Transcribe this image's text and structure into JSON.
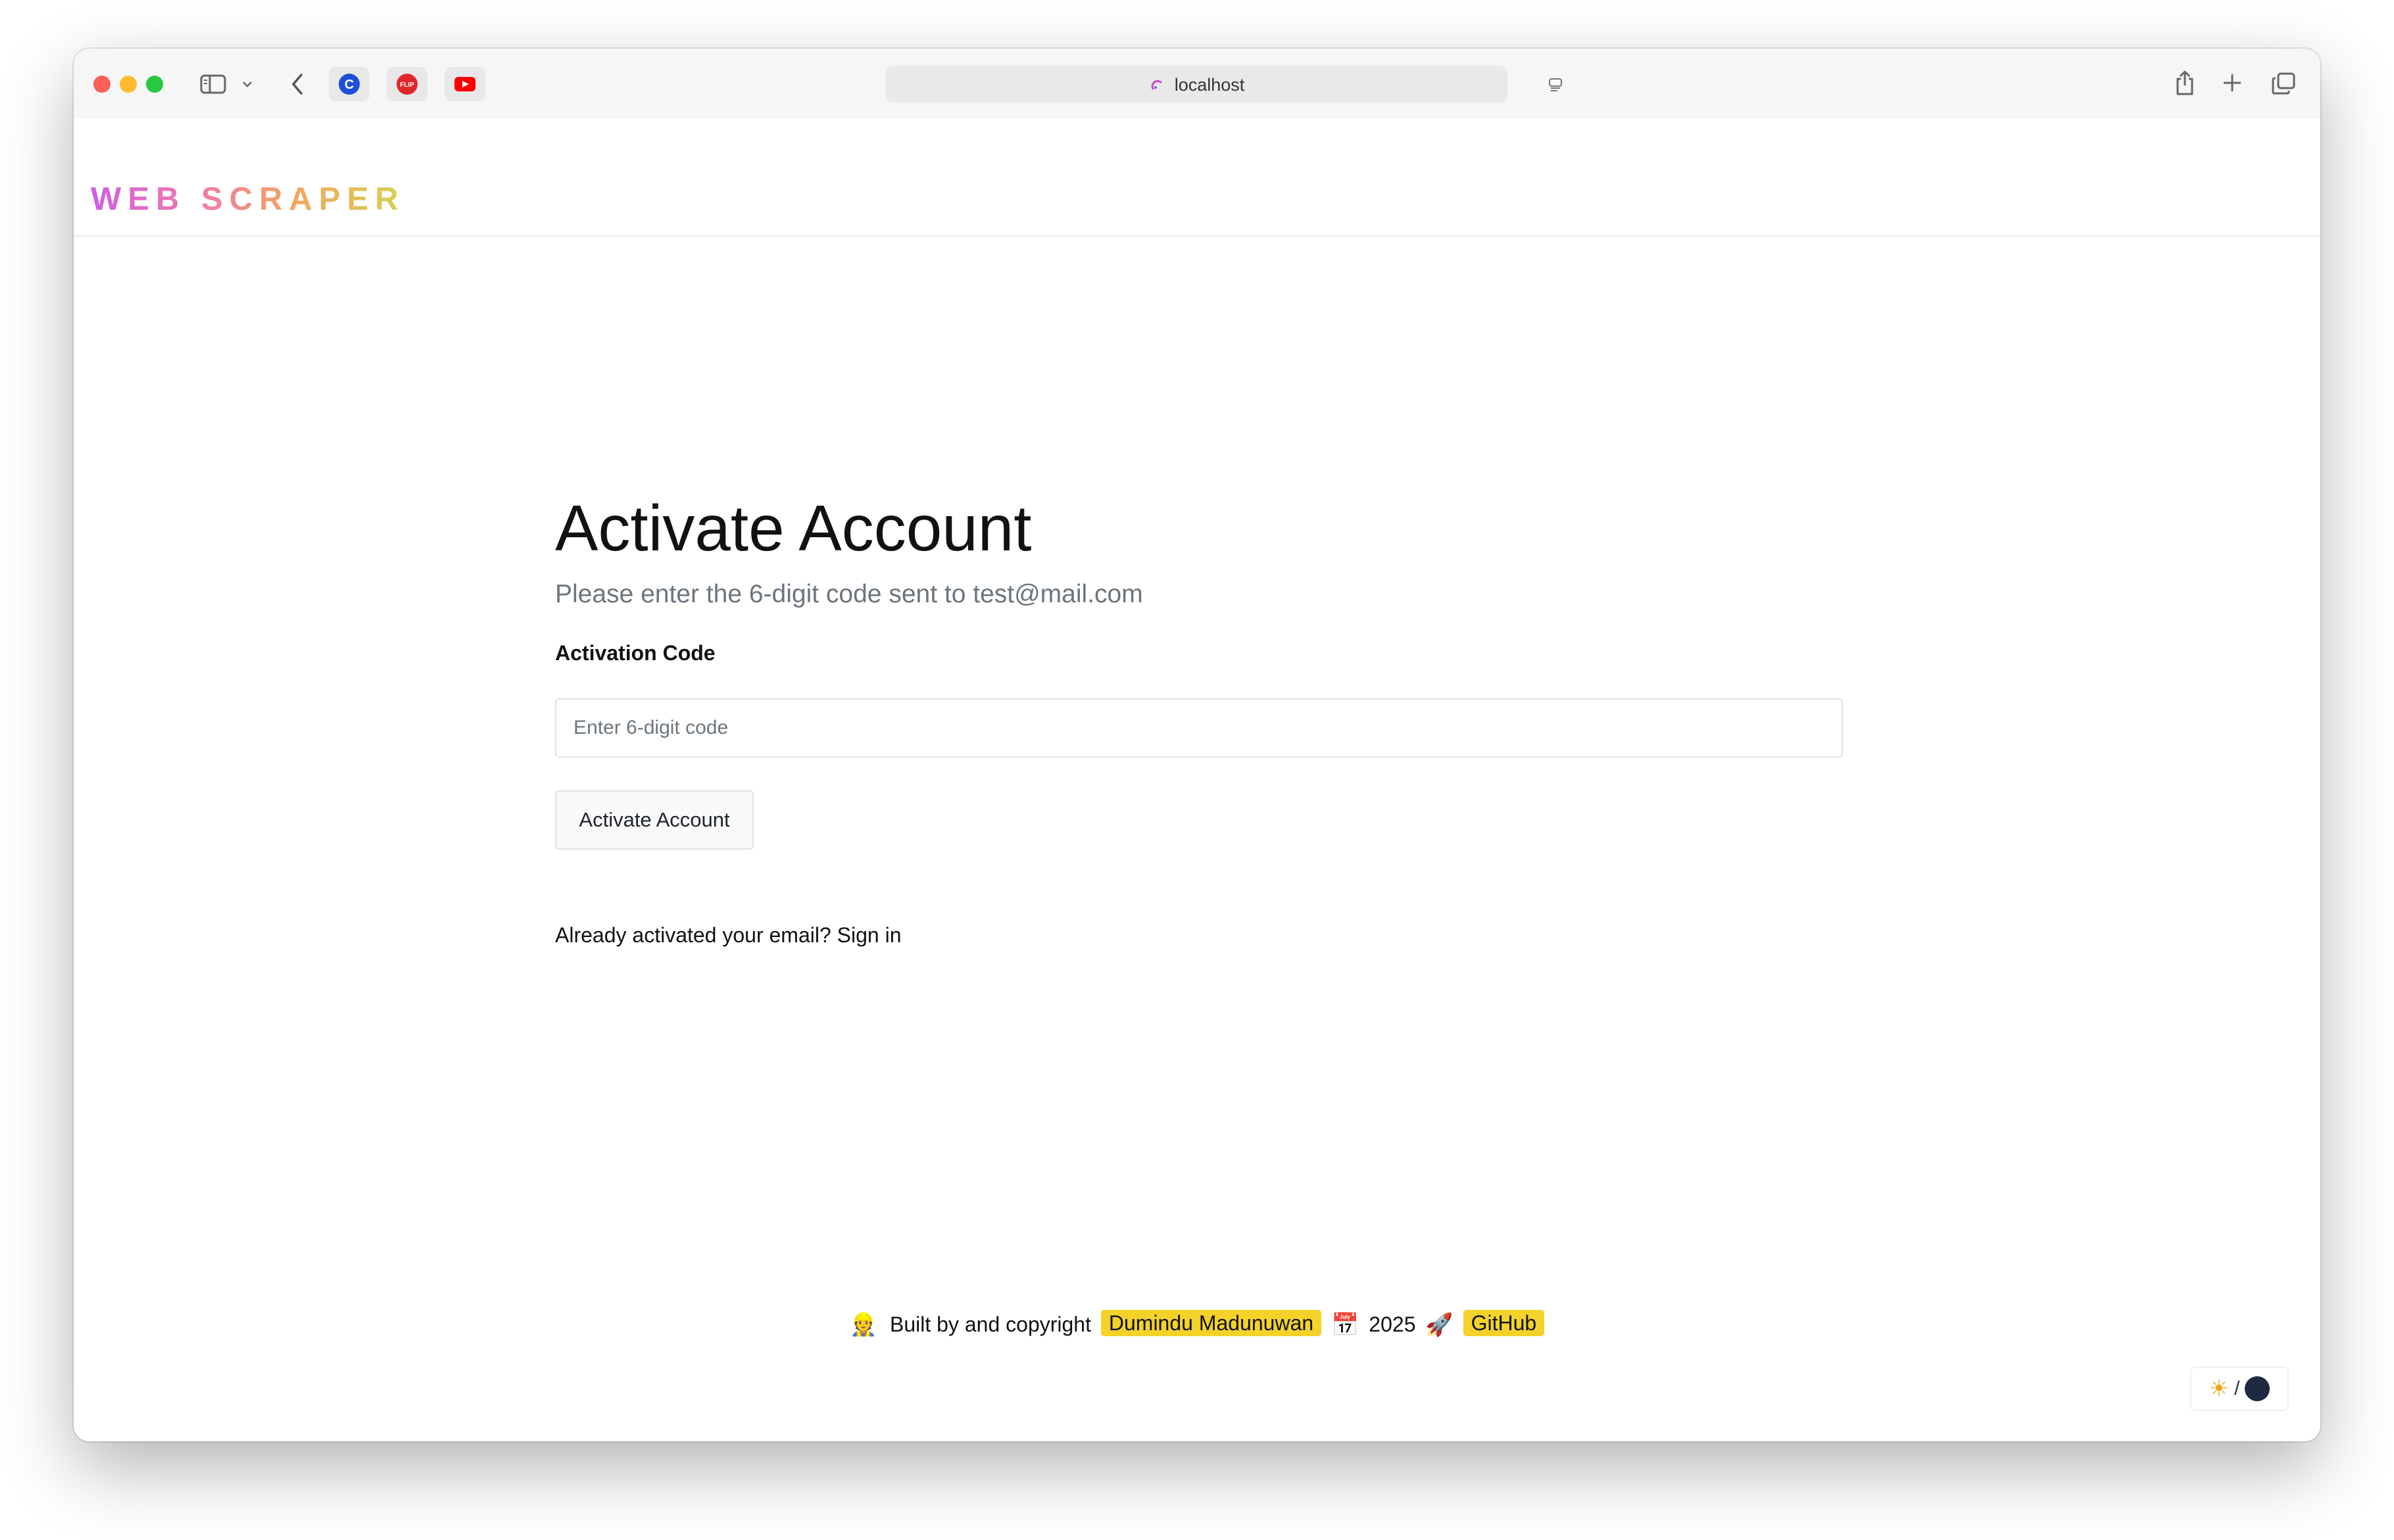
{
  "browser": {
    "url": "localhost",
    "traffic_colors": {
      "close": "#fe5f57",
      "minimize": "#febc2e",
      "zoom": "#28c840"
    },
    "favorites": [
      "c-logo-icon",
      "flip-logo-icon",
      "youtube-logo-icon"
    ]
  },
  "navbar": {
    "logo": "WEB SCRAPER"
  },
  "main": {
    "title": "Activate Account",
    "subtitle": "Please enter the 6-digit code sent to test@mail.com",
    "field_label": "Activation Code",
    "field_placeholder": "Enter 6-digit code",
    "field_value": "",
    "button_label": "Activate Account",
    "signin_prefix": "Already activated your email?",
    "signin_link": "Sign in"
  },
  "footer": {
    "emoji_builder": "👷",
    "text_built": "Built by and copyright",
    "author": "Dumindu Madunuwan",
    "emoji_calendar": "📅",
    "year": "2025",
    "emoji_rocket": "🚀",
    "github": "GitHub"
  },
  "theme_toggle": {
    "sun": "☀",
    "separator": "/"
  },
  "colors": {
    "highlight": "#f4d22a",
    "muted_text": "#6c757d"
  }
}
